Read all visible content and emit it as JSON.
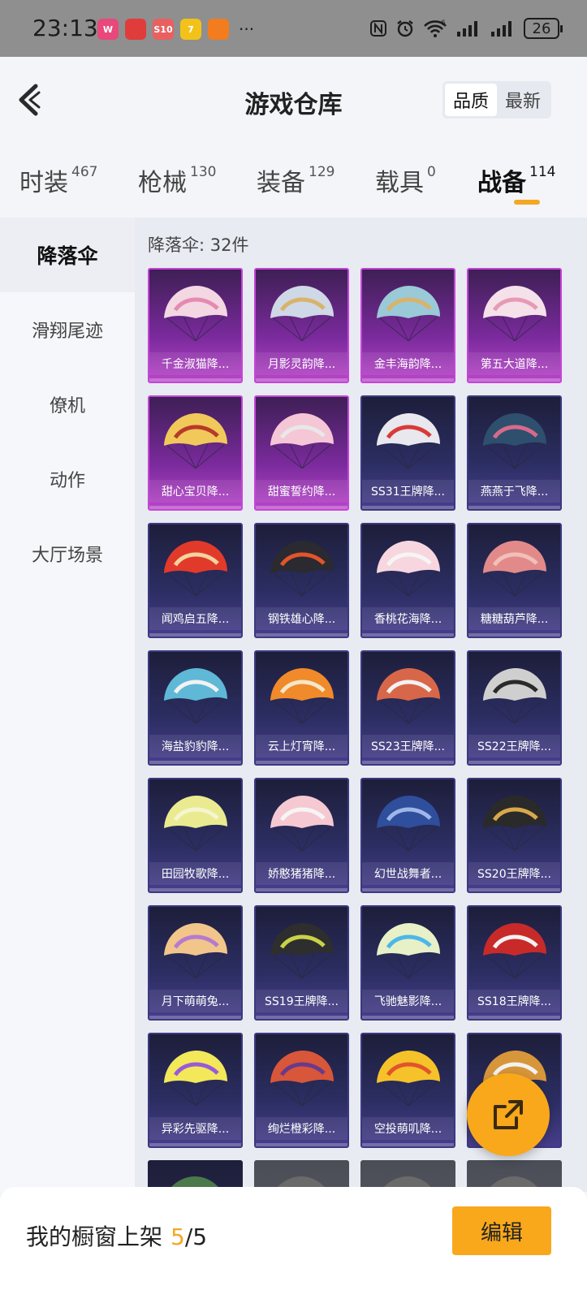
{
  "status_bar": {
    "time": "23:13",
    "app_icons": [
      {
        "name": "app-icon-1",
        "color": "#e8487a",
        "text": "W"
      },
      {
        "name": "app-icon-2",
        "color": "#e03c3c",
        "text": ""
      },
      {
        "name": "app-icon-3",
        "color": "#e86060",
        "text": "S10"
      },
      {
        "name": "app-icon-4",
        "color": "#f2c21a",
        "text": "7"
      },
      {
        "name": "app-icon-5",
        "color": "#f27c1e",
        "text": ""
      }
    ],
    "more": "···",
    "signal_label": "6",
    "battery": "26"
  },
  "header": {
    "title": "游戏仓库",
    "sort_quality": "品质",
    "sort_newest": "最新"
  },
  "tabs": [
    {
      "label": "时装",
      "count": "467"
    },
    {
      "label": "枪械",
      "count": "130"
    },
    {
      "label": "装备",
      "count": "129"
    },
    {
      "label": "载具",
      "count": "0"
    },
    {
      "label": "战备",
      "count": "114"
    }
  ],
  "sidebar": {
    "items": [
      {
        "label": "降落伞"
      },
      {
        "label": "滑翔尾迹"
      },
      {
        "label": "僚机"
      },
      {
        "label": "动作"
      },
      {
        "label": "大厅场景"
      }
    ]
  },
  "content": {
    "section_label": "降落伞: 32件",
    "items": [
      {
        "name": "千金淑猫降...",
        "tier": "purple",
        "canopy": "#f3d7e3",
        "trim": "#e58ab0"
      },
      {
        "name": "月影灵韵降...",
        "tier": "purple",
        "canopy": "#cfd8e6",
        "trim": "#d9b36a"
      },
      {
        "name": "金丰海韵降...",
        "tier": "purple",
        "canopy": "#9ac9d8",
        "trim": "#d9b36a"
      },
      {
        "name": "第五大道降...",
        "tier": "purple",
        "canopy": "#f5e1ea",
        "trim": "#e79ab4"
      },
      {
        "name": "甜心宝贝降...",
        "tier": "purple",
        "canopy": "#f0c95a",
        "trim": "#b83a2a"
      },
      {
        "name": "甜蜜誓约降...",
        "tier": "purple",
        "canopy": "#f4c6d6",
        "trim": "#e8e8e8"
      },
      {
        "name": "SS31王牌降...",
        "tier": "blue",
        "canopy": "#e8e8ee",
        "trim": "#d83a3a"
      },
      {
        "name": "燕燕于飞降...",
        "tier": "blue",
        "canopy": "#2e4f6e",
        "trim": "#d76a8a"
      },
      {
        "name": "闻鸡启五降...",
        "tier": "blue",
        "canopy": "#e23a2a",
        "trim": "#f3d3a0"
      },
      {
        "name": "钢铁雄心降...",
        "tier": "blue",
        "canopy": "#2a2a30",
        "trim": "#e2542a"
      },
      {
        "name": "香桃花海降...",
        "tier": "blue",
        "canopy": "#f7d6df",
        "trim": "#f5f5f5"
      },
      {
        "name": "糖糖葫芦降...",
        "tier": "blue",
        "canopy": "#e28a8a",
        "trim": "#f1c0b8"
      },
      {
        "name": "海盐豹豹降...",
        "tier": "blue",
        "canopy": "#5fb8d6",
        "trim": "#f2f2f2"
      },
      {
        "name": "云上灯宵降...",
        "tier": "blue",
        "canopy": "#f08a2a",
        "trim": "#f4e6c8"
      },
      {
        "name": "SS23王牌降...",
        "tier": "blue",
        "canopy": "#d8674a",
        "trim": "#f2f2f2"
      },
      {
        "name": "SS22王牌降...",
        "tier": "blue",
        "canopy": "#cfcfcf",
        "trim": "#2a2a2a"
      },
      {
        "name": "田园牧歌降...",
        "tier": "blue",
        "canopy": "#eaea90",
        "trim": "#f5f5d0"
      },
      {
        "name": "娇憨猪猪降...",
        "tier": "blue",
        "canopy": "#f6c9d2",
        "trim": "#f5f5f5"
      },
      {
        "name": "幻世战舞者...",
        "tier": "blue",
        "canopy": "#2f4e9c",
        "trim": "#9fb6e8"
      },
      {
        "name": "SS20王牌降...",
        "tier": "blue",
        "canopy": "#2a2a2a",
        "trim": "#d8a84a"
      },
      {
        "name": "月下萌萌兔...",
        "tier": "blue",
        "canopy": "#f2c58a",
        "trim": "#b57ad0"
      },
      {
        "name": "SS19王牌降...",
        "tier": "blue",
        "canopy": "#2e2e2e",
        "trim": "#c8d24a"
      },
      {
        "name": "飞驰魅影降...",
        "tier": "blue",
        "canopy": "#e8f0c8",
        "trim": "#4ab8e8"
      },
      {
        "name": "SS18王牌降...",
        "tier": "blue",
        "canopy": "#c82a2a",
        "trim": "#f2f2f2"
      },
      {
        "name": "异彩先驱降...",
        "tier": "blue",
        "canopy": "#f2e85a",
        "trim": "#9a5ad8"
      },
      {
        "name": "绚烂橙彩降...",
        "tier": "blue",
        "canopy": "#d8563a",
        "trim": "#6a3a8a"
      },
      {
        "name": "空投萌叽降...",
        "tier": "blue",
        "canopy": "#f5c22a",
        "trim": "#e2542a"
      },
      {
        "name": "",
        "tier": "blue",
        "canopy": "#d8963a",
        "trim": "#f2f2f2"
      },
      {
        "name": "",
        "tier": "dark",
        "canopy": "#4a7a4a",
        "trim": "#2a2a2a"
      },
      {
        "name": "",
        "tier": "gray",
        "canopy": "#6a6a6a",
        "trim": "#3a3a3a"
      },
      {
        "name": "",
        "tier": "gray",
        "canopy": "#6a6a6a",
        "trim": "#3a3a3a"
      },
      {
        "name": "",
        "tier": "gray",
        "canopy": "#6a6a6a",
        "trim": "#3a3a3a"
      }
    ]
  },
  "footer": {
    "label": "我的橱窗上架",
    "current": "5",
    "total": "/5",
    "edit_button": "编辑"
  },
  "colors": {
    "accent": "#f8a81a",
    "purple_tier": "#c445d8",
    "blue_tier": "#3b3980"
  }
}
